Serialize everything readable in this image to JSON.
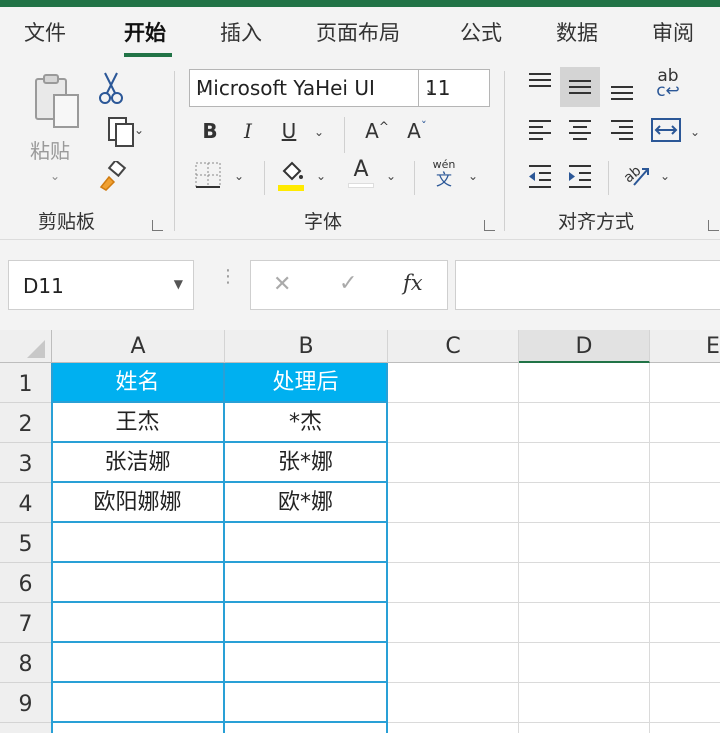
{
  "tabs": [
    "文件",
    "开始",
    "插入",
    "页面布局",
    "公式",
    "数据",
    "审阅"
  ],
  "ribbon": {
    "clipboard": {
      "paste_label": "粘贴",
      "group_label": "剪贴板"
    },
    "font": {
      "font_name": "Microsoft YaHei UI",
      "font_size": "11",
      "bold": "B",
      "italic": "I",
      "underline": "U",
      "grow": "A",
      "shrink": "A",
      "font_color": "A",
      "phonetic_top": "wén",
      "phonetic_bottom": "文",
      "group_label": "字体"
    },
    "alignment": {
      "group_label": "对齐方式",
      "wrap_top": "ab",
      "wrap_bottom": "c"
    }
  },
  "formula_bar": {
    "name_box": "D11",
    "cancel": "✕",
    "enter": "✓",
    "fx": "fx",
    "formula_value": ""
  },
  "grid": {
    "columns": [
      "A",
      "B",
      "C",
      "D",
      "E"
    ],
    "selected_column": "D",
    "rows": [
      "1",
      "2",
      "3",
      "4",
      "5",
      "6",
      "7",
      "8",
      "9"
    ],
    "table": {
      "headers": [
        "姓名",
        "处理后"
      ],
      "rows": [
        [
          "王杰",
          "*杰"
        ],
        [
          "张洁娜",
          "张*娜"
        ],
        [
          "欧阳娜娜",
          "欧*娜"
        ]
      ]
    }
  },
  "colors": {
    "accent": "#217346",
    "header_fill": "#00B0F0",
    "table_border": "#29A0D6"
  }
}
